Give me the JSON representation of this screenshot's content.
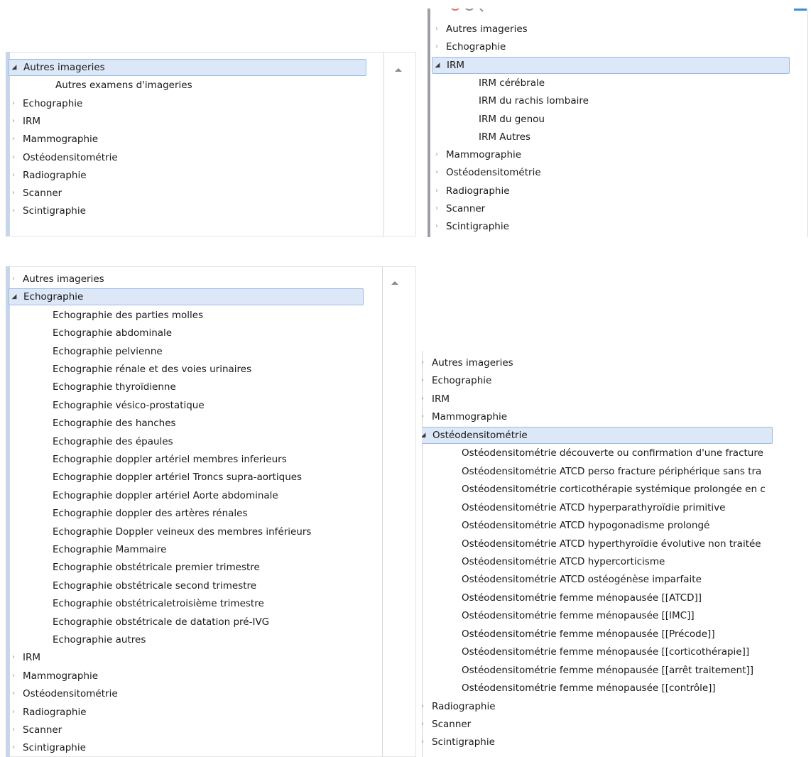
{
  "colors": {
    "selected_bg": "#dce8f7",
    "selected_border": "#9dbbe3",
    "left_bar": "#c7d6ea"
  },
  "icons": {
    "collapsed": "chevron-right-icon",
    "expanded": "triangle-down-icon",
    "scroll": "scroll-up-icon"
  },
  "glyphs": {
    "collapsed": "›",
    "expanded": "◢",
    "scroll": "▲"
  },
  "panels": [
    {
      "id": "p1",
      "items": [
        {
          "label": "Autres imageries",
          "expanded": true,
          "selected": true,
          "children": [
            "Autres examens d'imageries"
          ]
        },
        {
          "label": "Echographie"
        },
        {
          "label": "IRM"
        },
        {
          "label": "Mammographie"
        },
        {
          "label": "Ostéodensitométrie"
        },
        {
          "label": "Radiographie"
        },
        {
          "label": "Scanner"
        },
        {
          "label": "Scintigraphie"
        }
      ]
    },
    {
      "id": "p2",
      "items": [
        {
          "label": "Autres imageries"
        },
        {
          "label": "Echographie"
        },
        {
          "label": "IRM",
          "expanded": true,
          "selected": true,
          "children": [
            "IRM cérébrale",
            "IRM du rachis lombaire",
            "IRM du genou",
            "IRM Autres"
          ]
        },
        {
          "label": "Mammographie"
        },
        {
          "label": "Ostéodensitométrie"
        },
        {
          "label": "Radiographie"
        },
        {
          "label": "Scanner"
        },
        {
          "label": "Scintigraphie"
        }
      ]
    },
    {
      "id": "p3",
      "items": [
        {
          "label": "Autres imageries"
        },
        {
          "label": "Echographie",
          "expanded": true,
          "selected": true,
          "children": [
            "Echographie des parties molles",
            "Echographie abdominale",
            "Echographie pelvienne",
            "Echographie rénale et des voies urinaires",
            "Echographie thyroïdienne",
            "Echographie vésico-prostatique",
            "Echographie des hanches",
            "Echographie des épaules",
            "Echographie doppler artériel membres inferieurs",
            "Echographie doppler artériel Troncs supra-aortiques",
            "Echographie doppler artériel Aorte abdominale",
            "Echographie doppler des artères rénales",
            "Echographie Doppler veineux des membres inférieurs",
            "Echographie Mammaire",
            "Echographie obstétricale premier trimestre",
            "Echographie obstétricale second trimestre",
            "Echographie obstétricaletroisième trimestre",
            "Echographie obstétricale de datation pré-IVG",
            "Echographie autres"
          ]
        },
        {
          "label": "IRM"
        },
        {
          "label": "Mammographie"
        },
        {
          "label": "Ostéodensitométrie"
        },
        {
          "label": "Radiographie"
        },
        {
          "label": "Scanner"
        },
        {
          "label": "Scintigraphie"
        }
      ]
    },
    {
      "id": "p4",
      "items": [
        {
          "label": "Autres imageries"
        },
        {
          "label": "Echographie"
        },
        {
          "label": "IRM"
        },
        {
          "label": "Mammographie"
        },
        {
          "label": "Ostéodensitométrie",
          "expanded": true,
          "selected": true,
          "children": [
            "Ostéodensitométrie découverte ou confirmation d'une fracture",
            "Ostéodensitométrie ATCD perso fracture périphérique sans tra",
            "Ostéodensitométrie corticothérapie systémique prolongée en c",
            "Ostéodensitométrie ATCD hyperparathyroïdie primitive",
            "Ostéodensitométrie ATCD hypogonadisme prolongé",
            "Ostéodensitométrie ATCD hyperthyroïdie évolutive non traitée",
            "Ostéodensitométrie ATCD hypercorticisme",
            "Ostéodensitométrie ATCD ostéogénèse imparfaite",
            "Ostéodensitométrie femme ménopausée [[ATCD]]",
            "Ostéodensitométrie femme ménopausée [[IMC]]",
            "Ostéodensitométrie femme ménopausée [[Précode]]",
            "Ostéodensitométrie femme ménopausée [[corticothérapie]]",
            "Ostéodensitométrie femme ménopausée [[arrêt traitement]]",
            "Ostéodensitométrie femme ménopausée [[contrôle]]"
          ]
        },
        {
          "label": "Radiographie"
        },
        {
          "label": "Scanner"
        },
        {
          "label": "Scintigraphie"
        }
      ]
    }
  ]
}
